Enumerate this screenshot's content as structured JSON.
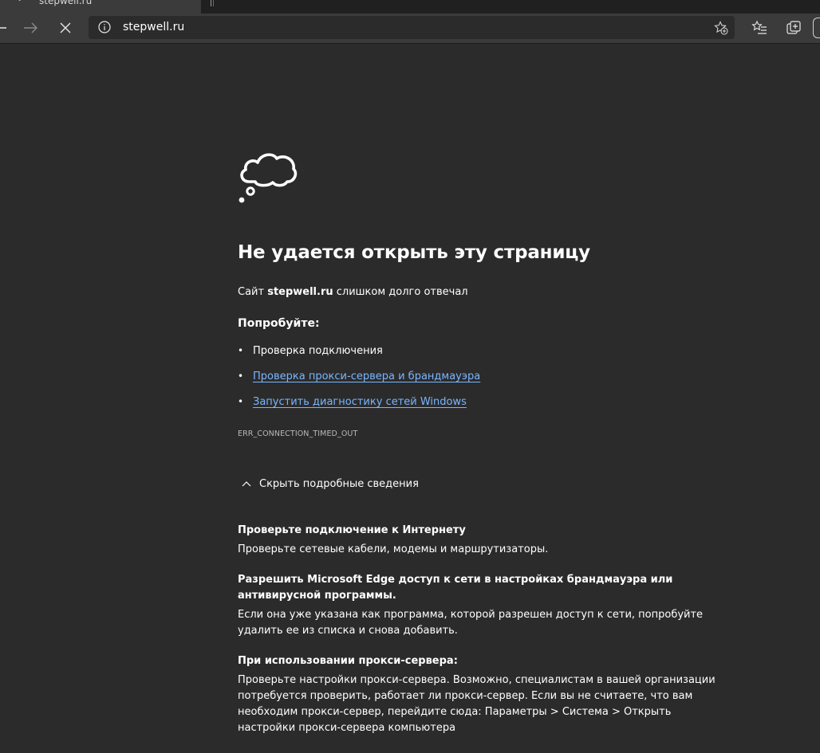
{
  "browser": {
    "tab_title": "stepwell.ru",
    "address": "stepwell.ru",
    "icons": {
      "back": "back-arrow-icon",
      "forward": "forward-arrow-icon",
      "stop": "close-icon",
      "info": "info-icon",
      "add_favorite": "star-add-icon",
      "favorites": "favorites-list-icon",
      "collections": "collections-icon"
    }
  },
  "error": {
    "icon": "thought-cloud-icon",
    "title": "Не удается открыть эту страницу",
    "desc_prefix": "Сайт ",
    "desc_host": "stepwell.ru",
    "desc_suffix": " слишком долго отвечал",
    "try_label": "Попробуйте:",
    "suggestions": [
      {
        "text": "Проверка подключения",
        "link": false
      },
      {
        "text": "Проверка прокси-сервера и брандмауэра",
        "link": true
      },
      {
        "text": "Запустить диагностику сетей Windows",
        "link": true
      }
    ],
    "code": "ERR_CONNECTION_TIMED_OUT",
    "details_toggle": "Скрыть подробные сведения",
    "details": [
      {
        "title": "Проверьте подключение к Интернету",
        "body": "Проверьте сетевые кабели, модемы и маршрутизаторы."
      },
      {
        "title": "Разрешить Microsoft Edge доступ к сети в настройках брандмауэра или антивирусной программы.",
        "body": "Если она уже указана как программа, которой разрешен доступ к сети, попробуйте удалить ее из списка и снова добавить."
      },
      {
        "title": "При использовании прокси-сервера:",
        "body": "Проверьте настройки прокси-сервера. Возможно, специалистам в вашей организации потребуется проверить, работает ли прокси-сервер. Если вы не считаете, что вам необходим прокси-сервер, перейдите сюда: Параметры > Система > Открыть настройки прокси-сервера компьютера"
      }
    ]
  },
  "colors": {
    "page_bg": "#2b2b2b",
    "toolbar_bg": "#3b3b3b",
    "link": "#7ab5ff",
    "text": "#ffffff"
  }
}
